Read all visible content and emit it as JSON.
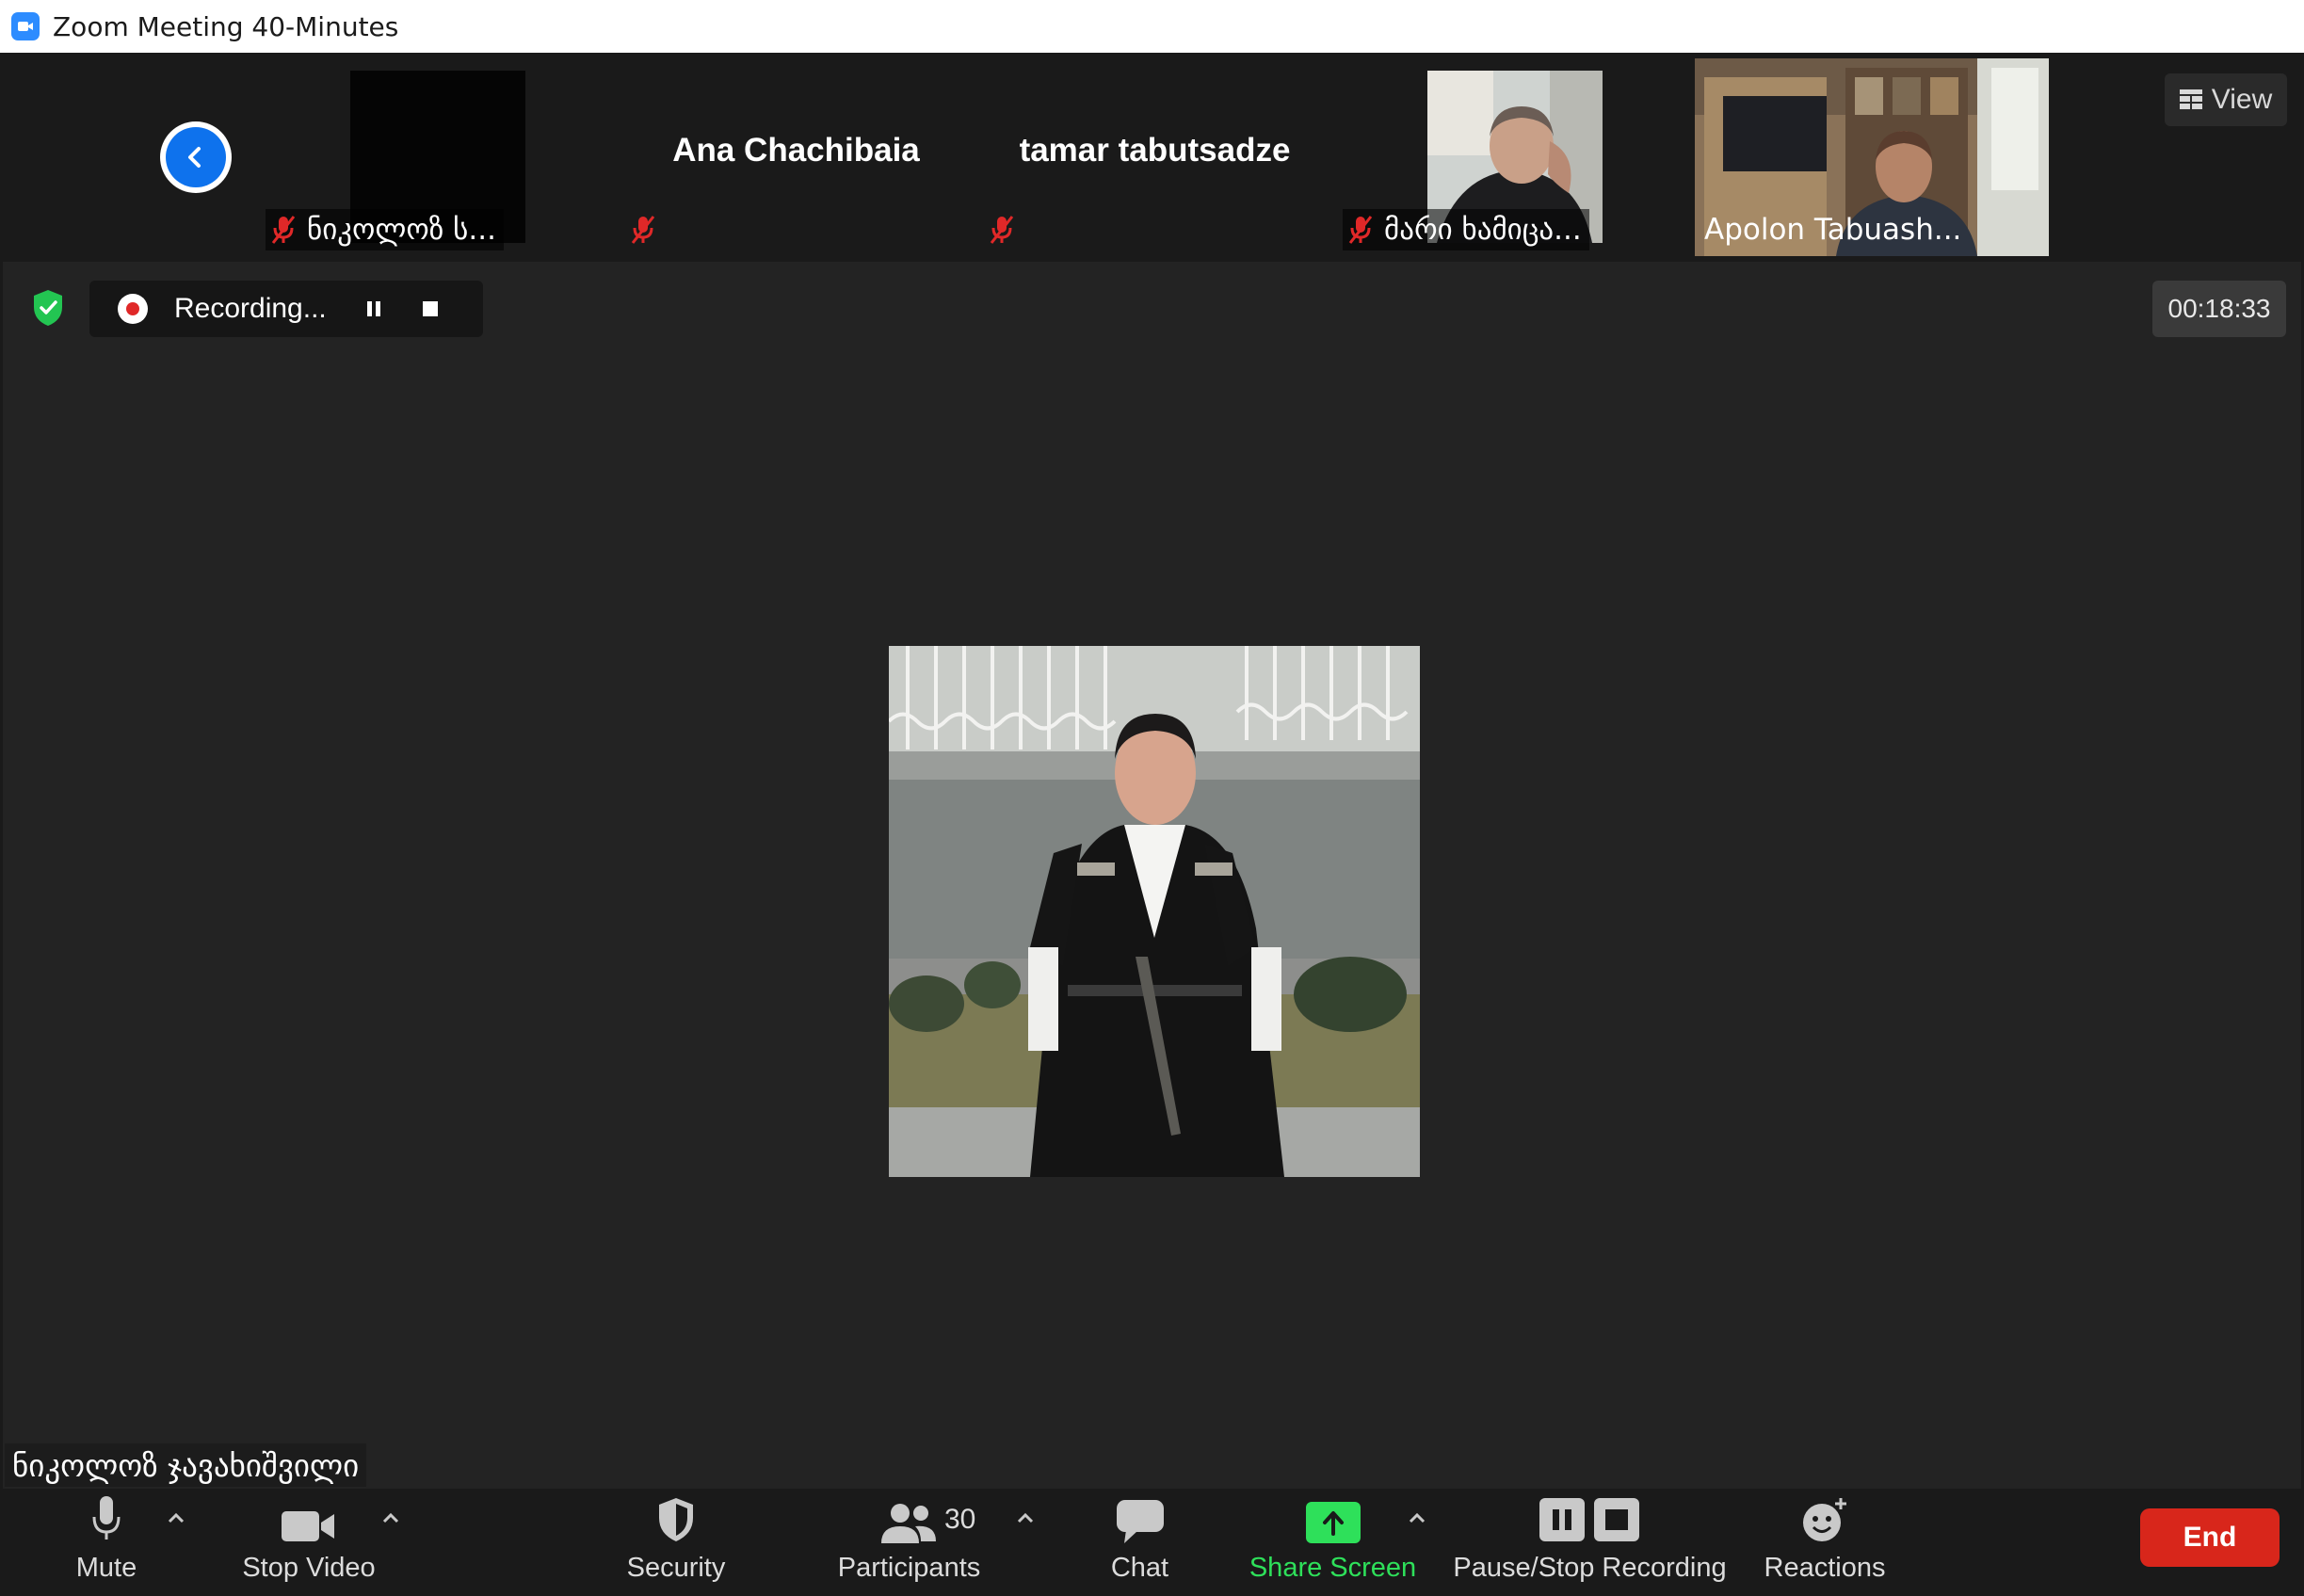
{
  "window": {
    "title": "Zoom Meeting 40-Minutes"
  },
  "thumbnails": [
    {
      "name": "ნიკოლოზ ს...",
      "muted": true,
      "has_video": false
    },
    {
      "name": "Ana Chachibaia",
      "muted": true,
      "has_video": false
    },
    {
      "name": "tamar tabutsadze",
      "muted": true,
      "has_video": false
    },
    {
      "name": "მარი ხამიცა...",
      "muted": true,
      "has_video": true
    },
    {
      "name": "Apolon Tabuash...",
      "muted": false,
      "has_video": true
    }
  ],
  "view_button": {
    "label": "View"
  },
  "recording": {
    "status": "Recording..."
  },
  "timer": "00:18:33",
  "active_speaker": {
    "name": "ნიკოლოზ ჯავახიშვილი"
  },
  "toolbar": {
    "mute": "Mute",
    "stop_video": "Stop Video",
    "security": "Security",
    "participants": "Participants",
    "participants_count": "30",
    "chat": "Chat",
    "share_screen": "Share Screen",
    "pause_stop_recording": "Pause/Stop Recording",
    "reactions": "Reactions",
    "end": "End"
  },
  "colors": {
    "accent_blue": "#0e72ed",
    "share_green": "#2ee05a",
    "end_red": "#d8261b",
    "mute_red": "#e02828",
    "background": "#232323"
  }
}
